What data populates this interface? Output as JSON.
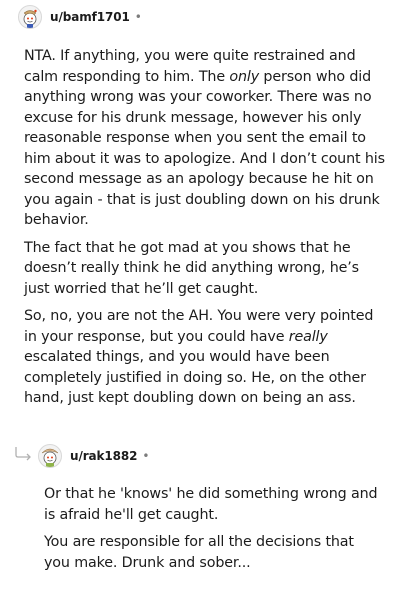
{
  "comments": [
    {
      "username": "u/bamf1701",
      "separator": "•",
      "paragraphs": [
        {
          "parts": [
            "NTA. If anything, you were quite restrained and calm responding to him. The ",
            "only",
            " person who did anything wrong was your coworker. There was no excuse for his drunk message, however his only reasonable response when you sent the email to him about it was to apologize. And I don’t count his second message as an apology because he hit on you again - that is just doubling down on his drunk behavior."
          ]
        },
        {
          "text": "The fact that he got mad at you shows that he doesn’t really think he did anything wrong, he’s just worried that he’ll get caught."
        },
        {
          "parts": [
            "So, no, you are not the AH. You were very pointed in your response, but you could have ",
            "really",
            " escalated things, and you would have been completely justified in doing so. He, on the other hand, just kept doubling down on being an ass."
          ]
        }
      ]
    },
    {
      "username": "u/rak1882",
      "separator": "•",
      "paragraphs": [
        {
          "text": "Or that he 'knows' he did something wrong and is afraid he'll get caught."
        },
        {
          "text": "You are responsible for all the decisions that you make. Drunk and sober..."
        }
      ]
    }
  ],
  "icons": {
    "avatar": "reddit-snoo-avatar-icon",
    "reply": "reply-arrow-icon"
  },
  "colors": {
    "text": "#1c1c1c",
    "meta": "#7c7c7c",
    "background": "#ffffff"
  }
}
